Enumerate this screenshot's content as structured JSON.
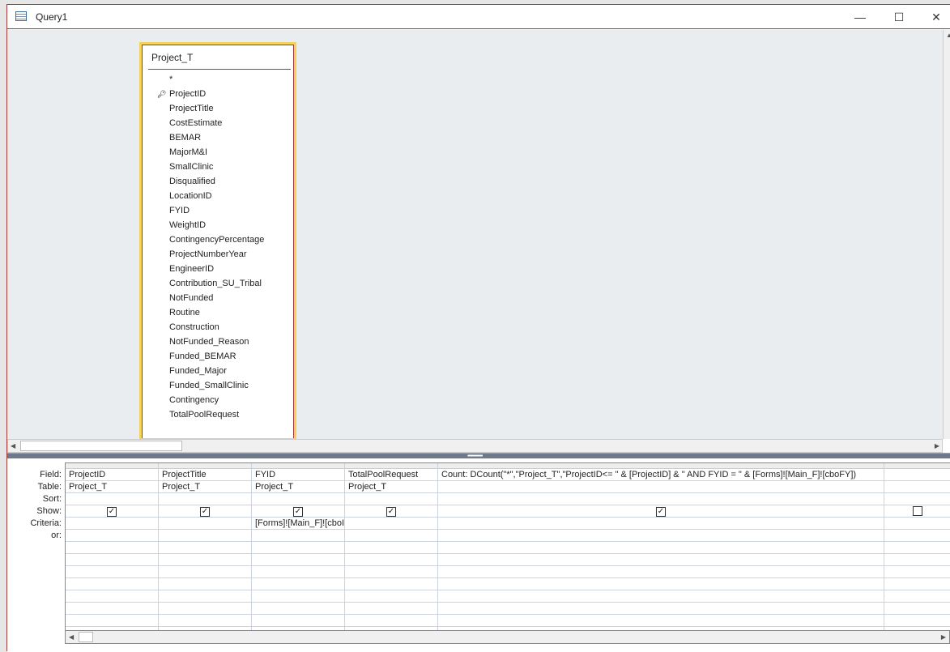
{
  "window": {
    "title": "Query1",
    "minimize": "—",
    "maximize": "☐",
    "close": "✕"
  },
  "table": {
    "name": "Project_T",
    "fields": [
      "*",
      "ProjectID",
      "ProjectTitle",
      "CostEstimate",
      "BEMAR",
      "MajorM&I",
      "SmallClinic",
      "Disqualified",
      "LocationID",
      "FYID",
      "WeightID",
      "ContingencyPercentage",
      "ProjectNumberYear",
      "EngineerID",
      "Contribution_SU_Tribal",
      "NotFunded",
      "Routine",
      "Construction",
      "NotFunded_Reason",
      "Funded_BEMAR",
      "Funded_Major",
      "Funded_SmallClinic",
      "Contingency",
      "TotalPoolRequest"
    ],
    "primary_key": "ProjectID"
  },
  "grid": {
    "row_labels": [
      "Field:",
      "Table:",
      "Sort:",
      "Show:",
      "Criteria:",
      "or:"
    ],
    "columns": [
      {
        "field": "ProjectID",
        "table": "Project_T",
        "sort": "",
        "show": true,
        "criteria": "",
        "or": ""
      },
      {
        "field": "ProjectTitle",
        "table": "Project_T",
        "sort": "",
        "show": true,
        "criteria": "",
        "or": ""
      },
      {
        "field": "FYID",
        "table": "Project_T",
        "sort": "",
        "show": true,
        "criteria": "[Forms]![Main_F]![cboI",
        "or": ""
      },
      {
        "field": "TotalPoolRequest",
        "table": "Project_T",
        "sort": "",
        "show": true,
        "criteria": "",
        "or": ""
      },
      {
        "field": "Count: DCount(\"*\",\"Project_T\",\"ProjectID<= \" & [ProjectID] & \" AND FYID = \" & [Forms]![Main_F]![cboFY])",
        "table": "",
        "sort": "",
        "show": true,
        "criteria": "",
        "or": ""
      },
      {
        "field": "",
        "table": "",
        "sort": "",
        "show": false,
        "criteria": "",
        "or": ""
      }
    ]
  }
}
